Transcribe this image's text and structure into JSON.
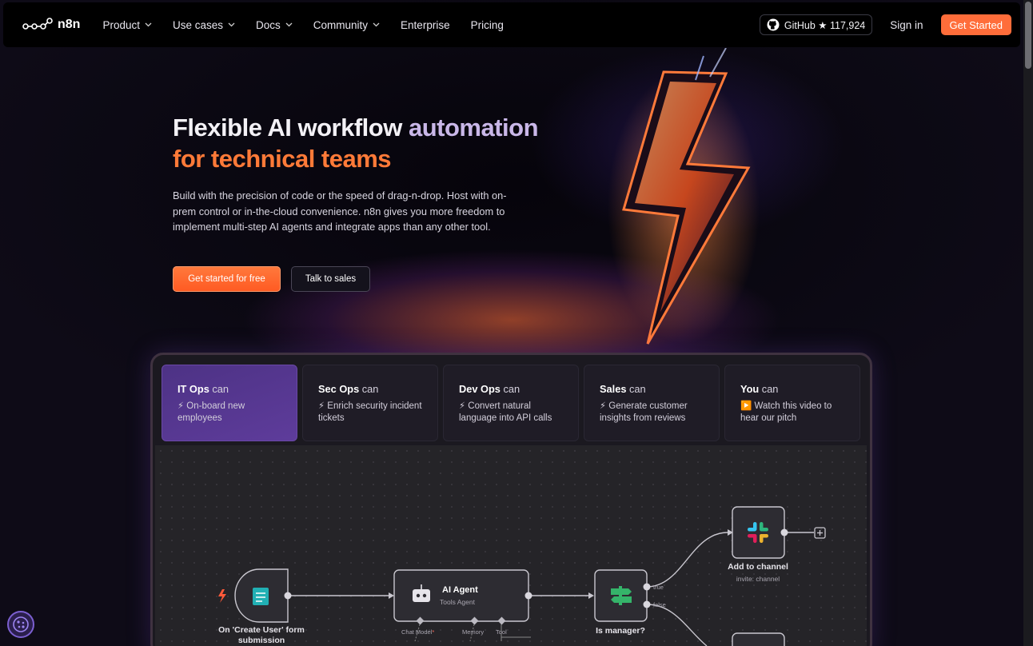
{
  "nav": {
    "logo_text": "n8n",
    "links": [
      {
        "label": "Product",
        "has_dropdown": true
      },
      {
        "label": "Use cases",
        "has_dropdown": true
      },
      {
        "label": "Docs",
        "has_dropdown": true
      },
      {
        "label": "Community",
        "has_dropdown": true
      },
      {
        "label": "Enterprise",
        "has_dropdown": false
      },
      {
        "label": "Pricing",
        "has_dropdown": false
      }
    ],
    "github_label": "GitHub ★ 117,924",
    "signin_label": "Sign in",
    "get_started_label": "Get Started"
  },
  "hero": {
    "title_part1": "Flexible AI workflow ",
    "title_part2": "automation",
    "title_line2": "for technical teams",
    "description": "Build with the precision of code or the speed of drag-n-drop. Host with on-prem control or in-the-cloud convenience. n8n gives you more freedom to implement multi-step AI agents and integrate apps than any other tool.",
    "primary_button": "Get started for free",
    "secondary_button": "Talk to sales"
  },
  "cards": [
    {
      "role": "IT Ops",
      "can": " can",
      "icon": "⚡",
      "text": "On-board new employees",
      "active": true
    },
    {
      "role": "Sec Ops",
      "can": " can",
      "icon": "⚡",
      "text": "Enrich security incident tickets",
      "active": false
    },
    {
      "role": "Dev Ops",
      "can": " can",
      "icon": "⚡",
      "text": "Convert natural language into API calls",
      "active": false
    },
    {
      "role": "Sales",
      "can": " can",
      "icon": "⚡",
      "text": "Generate customer insights from reviews",
      "active": false
    },
    {
      "role": "You",
      "can": " can",
      "icon": "▶️",
      "text": "Watch this video to hear our pitch",
      "active": false
    }
  ],
  "workflow": {
    "trigger_label": "On 'Create User' form submission",
    "agent_title": "AI Agent",
    "agent_subtitle": "Tools Agent",
    "port_chat_model": "Chat Model",
    "port_chat_model_required": "*",
    "port_memory": "Memory",
    "port_tool": "Tool",
    "if_label": "Is manager?",
    "branch_true": "true",
    "branch_false": "false",
    "slack_label": "Add to channel",
    "slack_sub": "invite: channel"
  },
  "colors": {
    "accent": "#ff6d3a",
    "active_card": "#5e3c9b",
    "background": "#0e0b17"
  }
}
